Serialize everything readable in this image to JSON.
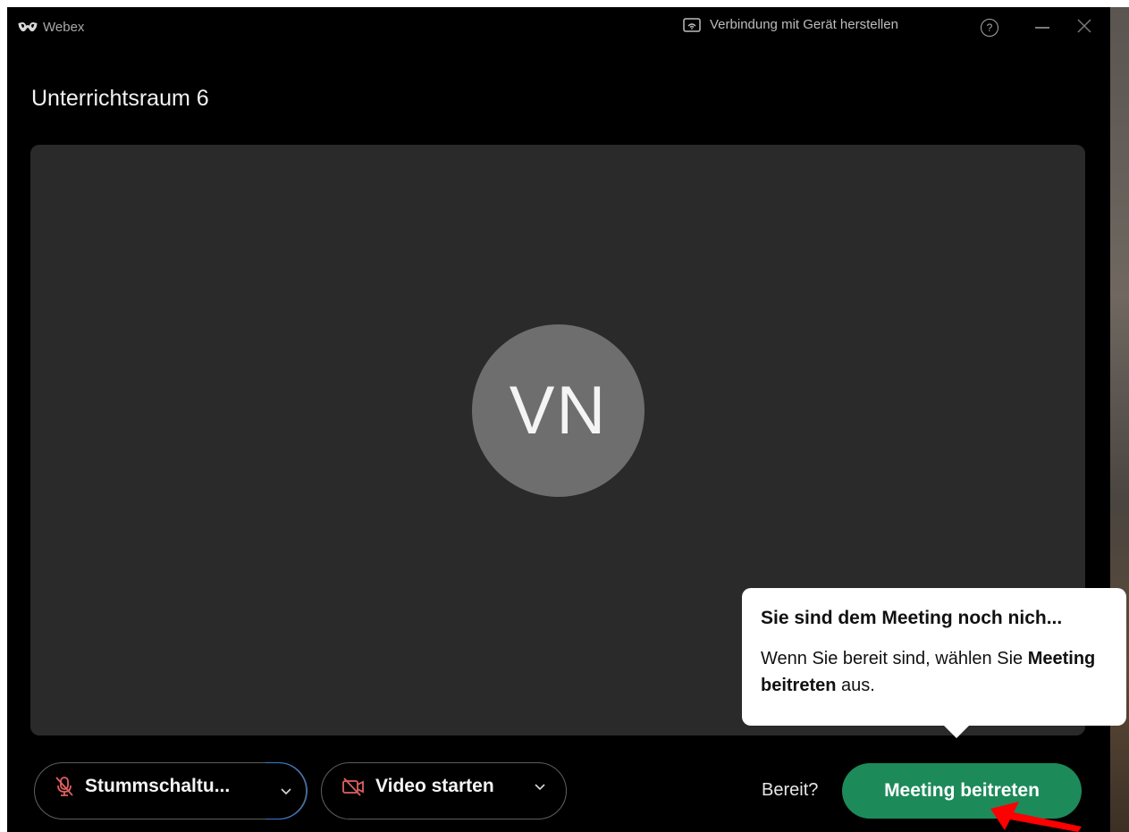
{
  "titlebar": {
    "app_name": "Webex",
    "connect_device_label": "Verbindung mit Gerät herstellen",
    "help_label": "?"
  },
  "meeting": {
    "title": "Unterrichtsraum 6",
    "avatar_initials": "VN"
  },
  "tooltip": {
    "title": "Sie sind dem Meeting noch nich...",
    "body_prefix": "Wenn Sie bereit sind, wählen Sie",
    "body_bold": "Meeting beitreten",
    "body_suffix": "aus."
  },
  "controls": {
    "mute_label": "Stummschaltu...",
    "video_label": "Video starten",
    "ready_label": "Bereit?",
    "join_label": "Meeting beitreten"
  },
  "colors": {
    "join_button": "#1d8a5a",
    "muted_icon": "#e06060",
    "focus_ring": "#3a7bd5",
    "annotation_arrow": "#ff0000"
  }
}
